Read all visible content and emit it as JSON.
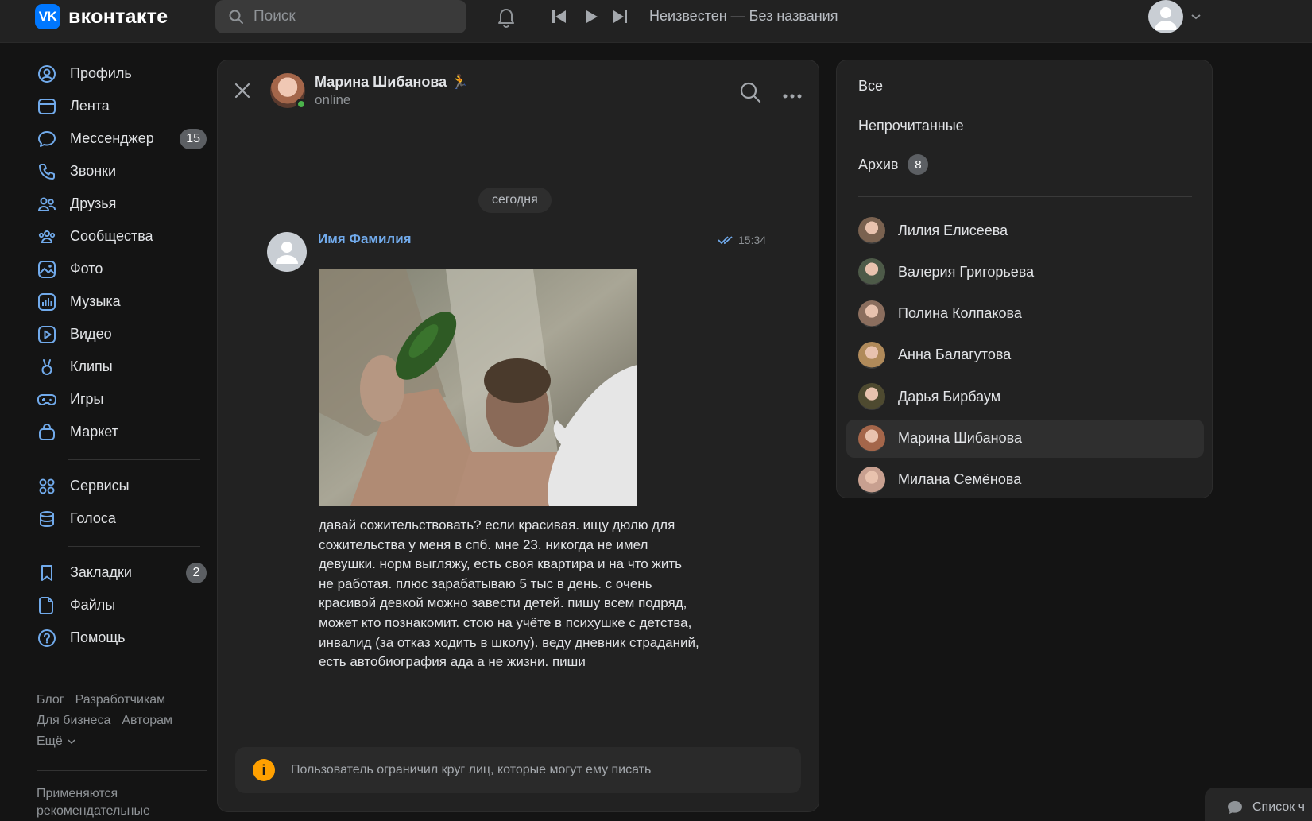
{
  "header": {
    "logo_text": "вконтакте",
    "logo_badge": "VK",
    "search_placeholder": "Поиск",
    "track_title": "Неизвестен — Без названия"
  },
  "nav": {
    "items": [
      {
        "label": "Профиль",
        "icon": "user-circle-icon"
      },
      {
        "label": "Лента",
        "icon": "newsfeed-icon"
      },
      {
        "label": "Мессенджер",
        "icon": "message-icon",
        "count": "15"
      },
      {
        "label": "Звонки",
        "icon": "phone-icon"
      },
      {
        "label": "Друзья",
        "icon": "friends-icon"
      },
      {
        "label": "Сообщества",
        "icon": "communities-icon"
      },
      {
        "label": "Фото",
        "icon": "photo-icon"
      },
      {
        "label": "Музыка",
        "icon": "music-icon"
      },
      {
        "label": "Видео",
        "icon": "video-icon"
      },
      {
        "label": "Клипы",
        "icon": "clips-icon"
      },
      {
        "label": "Игры",
        "icon": "gamepad-icon"
      },
      {
        "label": "Маркет",
        "icon": "market-bag-icon"
      }
    ],
    "items2": [
      {
        "label": "Сервисы",
        "icon": "services-grid-icon"
      },
      {
        "label": "Голоса",
        "icon": "coins-icon"
      }
    ],
    "items3": [
      {
        "label": "Закладки",
        "icon": "bookmark-icon",
        "count": "2"
      },
      {
        "label": "Файлы",
        "icon": "file-icon"
      },
      {
        "label": "Помощь",
        "icon": "help-icon"
      }
    ],
    "footer_links": [
      "Блог",
      "Разработчикам",
      "Для бизнеса",
      "Авторам",
      "Ещё"
    ],
    "footer_note": "Применяются рекомендательные"
  },
  "chat": {
    "peer_name": "Марина Шибанова",
    "peer_emoji": "🏃",
    "peer_status": "online",
    "date_label": "сегодня",
    "message": {
      "author": "Имя Фамилия",
      "time": "15:34",
      "text": "давай сожительствовать? если красивая. ищу дюлю для сожительства у меня в спб. мне 23. никогда не имел девушки. норм выгляжу, есть своя квартира и на что жить не работая. плюс зарабатываю 5 тыс в день. с очень красивой девкой можно завести детей. пишу всем подряд, может кто познакомит. стою на учёте в психушке с детства, инвалид (за отказ ходить в школу). веду дневник страданий, есть автобиография ада а не жизни. пиши"
    },
    "restriction_text": "Пользователь ограничил круг лиц, которые могут ему писать"
  },
  "side": {
    "folders": [
      {
        "label": "Все"
      },
      {
        "label": "Непрочитанные"
      },
      {
        "label": "Архив",
        "count": "8"
      }
    ],
    "dialogs": [
      {
        "name": "Лилия Елисеева",
        "color": "#7a6250"
      },
      {
        "name": "Валерия Григорьева",
        "color": "#4d5a48"
      },
      {
        "name": "Полина Колпакова",
        "color": "#8b6e5e"
      },
      {
        "name": "Анна Балагутова",
        "color": "#b08a5a"
      },
      {
        "name": "Дарья Бирбаум",
        "color": "#4e4a30"
      },
      {
        "name": "Марина Шибанова",
        "color": "#a4664a",
        "active": true
      },
      {
        "name": "Милана Семёнова",
        "color": "#c8a090"
      }
    ]
  },
  "chat_list_tab": "Список ч",
  "colors": {
    "accent": "#0077ff",
    "link": "#71aaeb",
    "online": "#4bb34b",
    "warning": "#ffa000",
    "background": "#141414",
    "panel": "#222222"
  }
}
